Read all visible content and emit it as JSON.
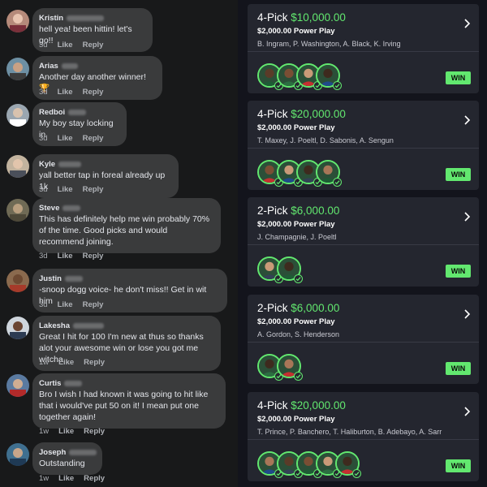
{
  "comments": [
    {
      "name": "Kristin",
      "text": "hell yea! been hittin! let's go!!",
      "time": "3d",
      "like": "Like",
      "reply": "Reply"
    },
    {
      "name": "Arias",
      "text": "Another day another winner! 🏆",
      "time": "3d",
      "like": "Like",
      "reply": "Reply"
    },
    {
      "name": "Redboi",
      "text": "My boy stay locking in",
      "time": "3d",
      "like": "Like",
      "reply": "Reply"
    },
    {
      "name": "Kyle",
      "text": "yall better tap in foreal already up 1k",
      "time": "3d",
      "like": "Like",
      "reply": "Reply"
    },
    {
      "name": "Steve",
      "text": "This has definitely help me win probably 70% of the time.  Good picks and would recommend joining.",
      "time": "3d",
      "like": "Like",
      "reply": "Reply"
    },
    {
      "name": "Justin",
      "text": "-snoop dogg voice- he don't miss!! Get in wit him",
      "time": "3d",
      "like": "Like",
      "reply": "Reply"
    },
    {
      "name": "Lakesha",
      "text": "Great I hit for 100 I'm new at thus so thanks alot your awesome win or lose you got me witcha",
      "time": "1w",
      "like": "Like",
      "reply": "Reply"
    },
    {
      "name": "Curtis",
      "text": "Bro I wish I had known it was going to hit like that i would've put 50 on it! I mean put one together again!",
      "time": "1w",
      "like": "Like",
      "reply": "Reply"
    },
    {
      "name": "Joseph",
      "text": "Outstanding",
      "time": "1w",
      "like": "Like",
      "reply": "Reply"
    }
  ],
  "picks": [
    {
      "label": "4-Pick",
      "payout": "$10,000.00",
      "stake": "$2,000.00 Power Play",
      "players": "B. Ingram, P. Washington, A. Black, K. Irving",
      "result": "WIN",
      "heads": 4
    },
    {
      "label": "4-Pick",
      "payout": "$20,000.00",
      "stake": "$2,000.00 Power Play",
      "players": "T. Maxey, J. Poeltl, D. Sabonis, A. Sengun",
      "result": "WIN",
      "heads": 4
    },
    {
      "label": "2-Pick",
      "payout": "$6,000.00",
      "stake": "$2,000.00 Power Play",
      "players": "J. Champagnie, J. Poeltl",
      "result": "WIN",
      "heads": 2
    },
    {
      "label": "2-Pick",
      "payout": "$6,000.00",
      "stake": "$2,000.00 Power Play",
      "players": "A. Gordon, S. Henderson",
      "result": "WIN",
      "heads": 2
    },
    {
      "label": "4-Pick",
      "payout": "$20,000.00",
      "stake": "$2,000.00 Power Play",
      "players": "T. Prince, P. Banchero, T. Haliburton, B. Adebayo, A. Sarr",
      "result": "WIN",
      "heads": 5
    }
  ],
  "colors": {
    "accent": "#62e86f",
    "bubble": "#3a3b3c",
    "card": "#24262f"
  }
}
